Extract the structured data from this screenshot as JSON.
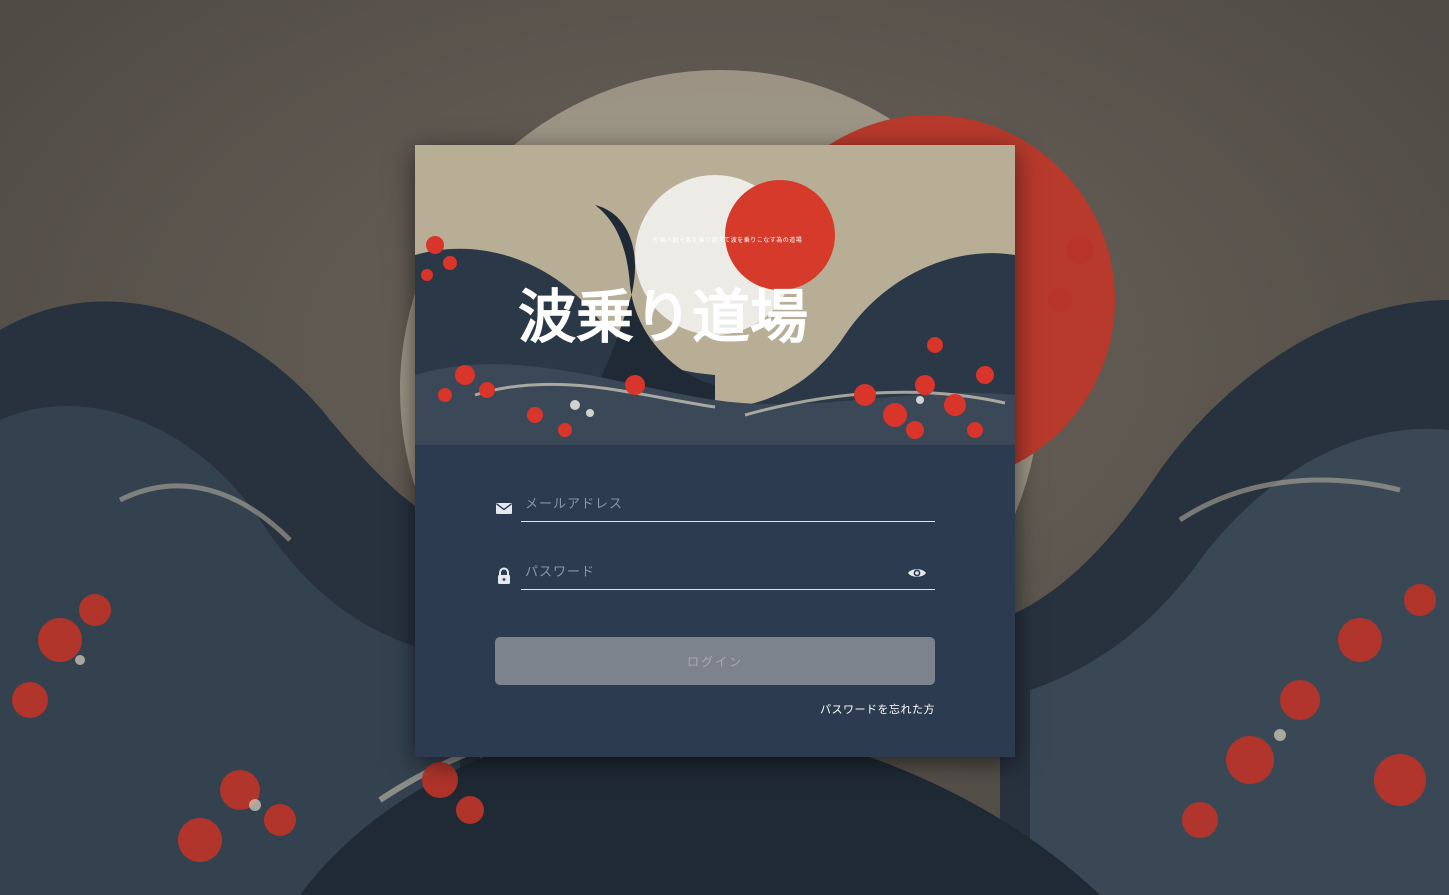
{
  "banner": {
    "logo_text": "波乗り道場",
    "subtitle": "外国人観光客を乗り越えて波を乗りこなす為の道場"
  },
  "form": {
    "email": {
      "placeholder": "メールアドレス",
      "value": "",
      "icon": "mail-icon"
    },
    "password": {
      "placeholder": "パスワード",
      "value": "",
      "icon": "lock-icon",
      "toggle_icon": "eye-icon"
    },
    "login_label": "ログイン",
    "forgot_label": "パスワードを忘れた方"
  },
  "colors": {
    "panel": "#2c3b50",
    "button_disabled": "#7d838c",
    "button_text": "#a6abb2",
    "accent_red": "#c0392b",
    "wave_navy": "#26323f",
    "paper": "#b8ad95"
  }
}
